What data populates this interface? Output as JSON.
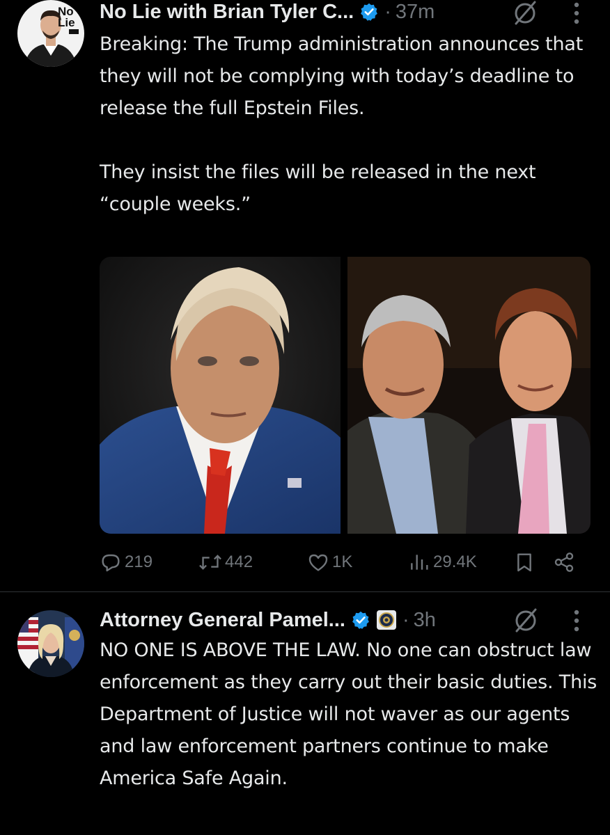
{
  "tweets": [
    {
      "author_name": "No Lie with Brian Tyler C...",
      "separator": "·",
      "time": "37m",
      "text": "Breaking: The Trump administration announces that they will not be complying with today’s deadline to release the full Epstein Files.\n\nThey insist the files will be released in the next “couple weeks.”",
      "avatar_logo": "No Lie",
      "media": [
        {
          "icon": "portrait-photo"
        },
        {
          "icon": "two-men-photo"
        }
      ],
      "actions": {
        "reply_count": "219",
        "repost_count": "442",
        "like_count": "1K",
        "views_count": "29.4K"
      }
    },
    {
      "author_name": "Attorney General Pamel...",
      "separator": "·",
      "time": "3h",
      "text": "NO ONE IS ABOVE THE LAW. No one can obstruct law enforcement as they carry out their basic duties. This Department of Justice will not waver as our agents and law enforcement partners continue to make America Safe Again."
    }
  ],
  "colors": {
    "background": "#000000",
    "text_primary": "#e7e9ea",
    "text_secondary": "#71767b",
    "verified_blue": "#1d9bf0",
    "divider": "#2f3336"
  },
  "icons": {
    "verified": "verified-badge-icon",
    "affiliate": "doj-seal-icon",
    "grok": "grok-icon",
    "more": "more-dots-icon",
    "reply": "reply-icon",
    "repost": "repost-icon",
    "like": "heart-icon",
    "views": "views-icon",
    "bookmark": "bookmark-icon",
    "share": "share-icon"
  }
}
